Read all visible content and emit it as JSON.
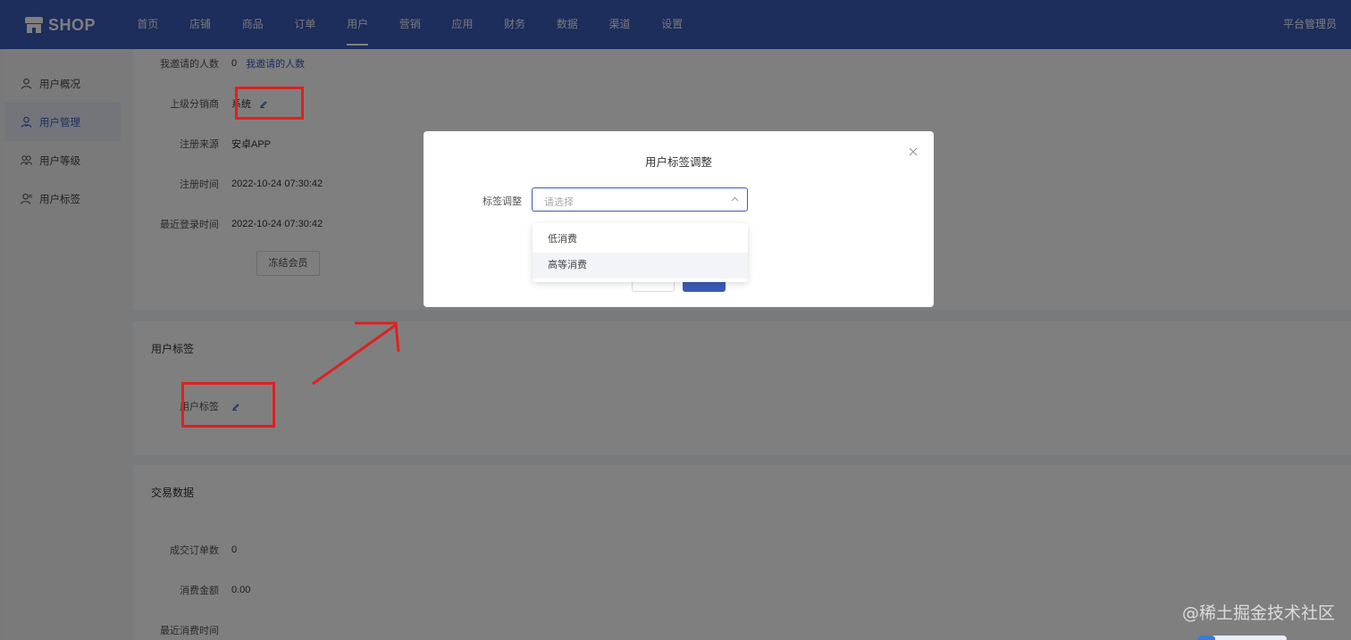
{
  "header": {
    "logo_text": "SHOP",
    "nav": [
      "首页",
      "店铺",
      "商品",
      "订单",
      "用户",
      "营销",
      "应用",
      "财务",
      "数据",
      "渠道",
      "设置"
    ],
    "active_nav": "用户",
    "admin_label": "平台管理员"
  },
  "sidebar": {
    "items": [
      {
        "label": "用户概况",
        "icon": "user-icon"
      },
      {
        "label": "用户管理",
        "icon": "user-manage-icon"
      },
      {
        "label": "用户等级",
        "icon": "users-icon"
      },
      {
        "label": "用户标签",
        "icon": "user-tag-icon"
      }
    ],
    "active": "用户管理"
  },
  "detail": {
    "invited": {
      "label": "我邀请的人数",
      "value": "0",
      "link": "我邀请的人数"
    },
    "superior": {
      "label": "上级分销商",
      "value": "系统"
    },
    "source": {
      "label": "注册来源",
      "value": "安卓APP"
    },
    "register_time": {
      "label": "注册时间",
      "value": "2022-10-24 07:30:42"
    },
    "last_login": {
      "label": "最近登录时间",
      "value": "2022-10-24 07:30:42"
    },
    "freeze_button": "冻结会员"
  },
  "tags_section": {
    "title": "用户标签",
    "label": "用户标签"
  },
  "trade_section": {
    "title": "交易数据",
    "orders": {
      "label": "成交订单数",
      "value": "0"
    },
    "amount": {
      "label": "消费金额",
      "value": "0.00"
    },
    "last_purchase": {
      "label": "最近消费时间",
      "value": ""
    }
  },
  "modal": {
    "title": "用户标签调整",
    "field_label": "标签调整",
    "placeholder": "请选择",
    "options": [
      "低消费",
      "高等消费"
    ],
    "hover_option": "高等消费"
  },
  "watermark": "@稀土掘金技术社区",
  "colors": {
    "primary": "#3a5bb8",
    "annotation": "#e02020"
  }
}
